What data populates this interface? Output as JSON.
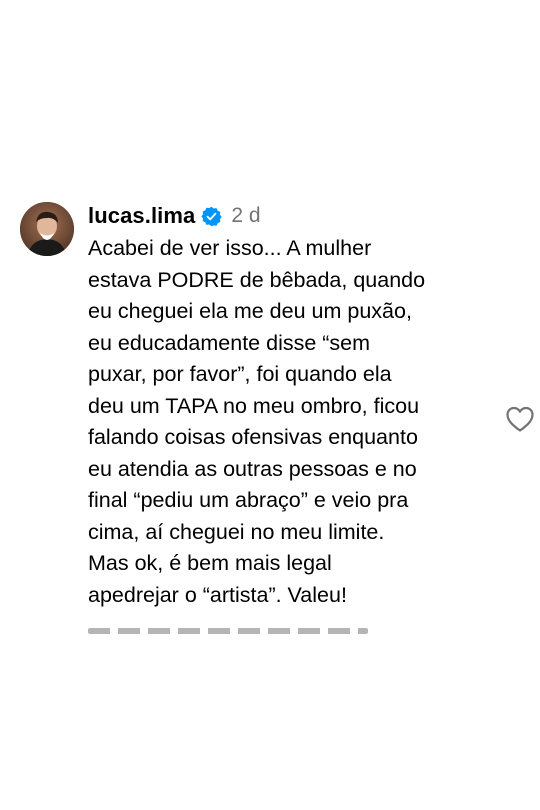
{
  "comment": {
    "username": "lucas.lima",
    "verified_icon": "verified-badge-icon",
    "timestamp": "2 d",
    "text": "Acabei de ver isso... A mulher\nestava PODRE de bêbada, quando\neu cheguei ela me deu um puxão,\neu educadamente disse “sem\npuxar, por favor”, foi quando ela\ndeu um TAPA no meu ombro, ficou\nfalando coisas ofensivas enquanto\neu atendia as outras pessoas e no\nfinal “pediu um abraço” e veio pra\ncima, aí cheguei no meu limite.\nMas ok, é bem mais legal\napedrejar o “artista”. Valeu!",
    "like_icon": "heart-outline-icon"
  },
  "colors": {
    "verified_blue": "#0095f6",
    "timestamp_gray": "#737373",
    "icon_gray": "#737373"
  }
}
